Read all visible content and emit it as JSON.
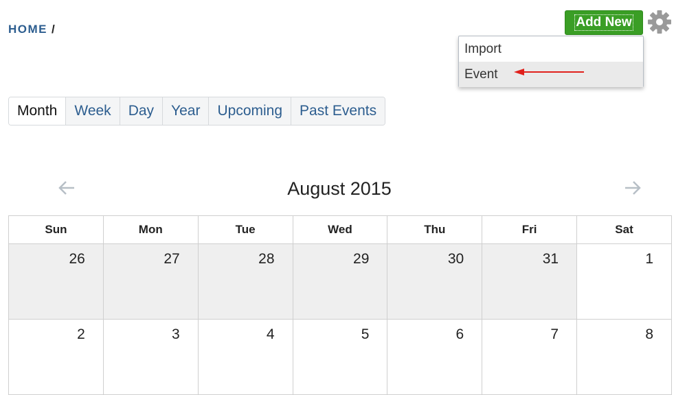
{
  "breadcrumb": {
    "home": "HOME",
    "separator": "/"
  },
  "toolbar": {
    "add_new_label": "Add New",
    "settings_icon": "gear-icon"
  },
  "dropdown": {
    "items": [
      "Import",
      "Event"
    ],
    "highlighted": "Event"
  },
  "annotation": {
    "color": "#e0201b"
  },
  "view_tabs": [
    "Month",
    "Week",
    "Day",
    "Year",
    "Upcoming",
    "Past Events"
  ],
  "active_view": "Month",
  "calendar": {
    "title": "August 2015",
    "prev_icon": "arrow-left-icon",
    "next_icon": "arrow-right-icon",
    "weekdays": [
      "Sun",
      "Mon",
      "Tue",
      "Wed",
      "Thu",
      "Fri",
      "Sat"
    ],
    "weeks": [
      [
        "26",
        "27",
        "28",
        "29",
        "30",
        "31",
        "1"
      ],
      [
        "2",
        "3",
        "4",
        "5",
        "6",
        "7",
        "8"
      ]
    ]
  },
  "colors": {
    "accent_green": "#3a9e25",
    "link_blue": "#2c5d8f",
    "other_month_bg": "#efefef"
  }
}
